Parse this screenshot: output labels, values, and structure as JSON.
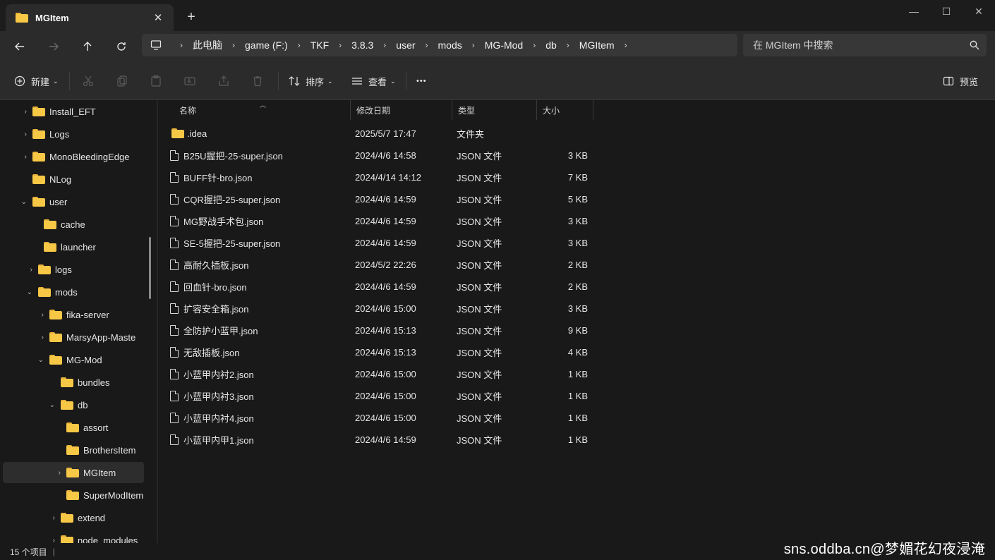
{
  "window": {
    "tab_title": "MGItem",
    "tab_close_glyph": "✕",
    "new_tab_glyph": "+",
    "minimize_glyph": "—",
    "maximize_glyph": "☐",
    "close_glyph": "✕"
  },
  "address": {
    "crumbs": [
      "此电脑",
      "game (F:)",
      "TKF",
      "3.8.3",
      "user",
      "mods",
      "MG-Mod",
      "db",
      "MGItem"
    ],
    "search_placeholder": "在 MGItem 中搜索"
  },
  "toolbar": {
    "new_label": "新建",
    "sort_label": "排序",
    "view_label": "查看",
    "more_glyph": "•••",
    "preview_label": "预览"
  },
  "nav_tree": [
    {
      "label": "Install_EFT",
      "chevron": "›"
    },
    {
      "label": "Logs",
      "chevron": "›"
    },
    {
      "label": "MonoBleedingEdge",
      "chevron": "›"
    },
    {
      "label": "NLog",
      "chevron": ""
    },
    {
      "label": "user",
      "chevron": "⌄"
    },
    {
      "label": "cache",
      "chevron": ""
    },
    {
      "label": "launcher",
      "chevron": ""
    },
    {
      "label": "logs",
      "chevron": "›"
    },
    {
      "label": "mods",
      "chevron": "⌄"
    },
    {
      "label": "fika-server",
      "chevron": "›"
    },
    {
      "label": "MarsyApp-Maste",
      "chevron": "›"
    },
    {
      "label": "MG-Mod",
      "chevron": "⌄"
    },
    {
      "label": "bundles",
      "chevron": ""
    },
    {
      "label": "db",
      "chevron": "⌄"
    },
    {
      "label": "assort",
      "chevron": ""
    },
    {
      "label": "BrothersItem",
      "chevron": ""
    },
    {
      "label": "MGItem",
      "chevron": "›"
    },
    {
      "label": "SuperModItem",
      "chevron": ""
    },
    {
      "label": "extend",
      "chevron": "›"
    },
    {
      "label": "node_modules",
      "chevron": "›"
    }
  ],
  "columns": {
    "name": "名称",
    "date": "修改日期",
    "type": "类型",
    "size": "大小",
    "sort_caret": "︿"
  },
  "files": [
    {
      "name": ".idea",
      "date": "2025/5/7 17:47",
      "type": "文件夹",
      "size": "",
      "kind": "folder"
    },
    {
      "name": "B25U握把-25-super.json",
      "date": "2024/4/6 14:58",
      "type": "JSON 文件",
      "size": "3 KB",
      "kind": "file"
    },
    {
      "name": "BUFF针-bro.json",
      "date": "2024/4/14 14:12",
      "type": "JSON 文件",
      "size": "7 KB",
      "kind": "file"
    },
    {
      "name": "CQR握把-25-super.json",
      "date": "2024/4/6 14:59",
      "type": "JSON 文件",
      "size": "5 KB",
      "kind": "file"
    },
    {
      "name": "MG野战手术包.json",
      "date": "2024/4/6 14:59",
      "type": "JSON 文件",
      "size": "3 KB",
      "kind": "file"
    },
    {
      "name": "SE-5握把-25-super.json",
      "date": "2024/4/6 14:59",
      "type": "JSON 文件",
      "size": "3 KB",
      "kind": "file"
    },
    {
      "name": "高耐久插板.json",
      "date": "2024/5/2 22:26",
      "type": "JSON 文件",
      "size": "2 KB",
      "kind": "file"
    },
    {
      "name": "回血针-bro.json",
      "date": "2024/4/6 14:59",
      "type": "JSON 文件",
      "size": "2 KB",
      "kind": "file"
    },
    {
      "name": "扩容安全箱.json",
      "date": "2024/4/6 15:00",
      "type": "JSON 文件",
      "size": "3 KB",
      "kind": "file"
    },
    {
      "name": "全防护小蓝甲.json",
      "date": "2024/4/6 15:13",
      "type": "JSON 文件",
      "size": "9 KB",
      "kind": "file"
    },
    {
      "name": "无敌插板.json",
      "date": "2024/4/6 15:13",
      "type": "JSON 文件",
      "size": "4 KB",
      "kind": "file"
    },
    {
      "name": "小蓝甲内衬2.json",
      "date": "2024/4/6 15:00",
      "type": "JSON 文件",
      "size": "1 KB",
      "kind": "file"
    },
    {
      "name": "小蓝甲内衬3.json",
      "date": "2024/4/6 15:00",
      "type": "JSON 文件",
      "size": "1 KB",
      "kind": "file"
    },
    {
      "name": "小蓝甲内衬4.json",
      "date": "2024/4/6 15:00",
      "type": "JSON 文件",
      "size": "1 KB",
      "kind": "file"
    },
    {
      "name": "小蓝甲内甲1.json",
      "date": "2024/4/6 14:59",
      "type": "JSON 文件",
      "size": "1 KB",
      "kind": "file"
    }
  ],
  "status": {
    "item_count": "15 个项目",
    "divider": "|"
  },
  "watermark": "sns.oddba.cn@梦媚花幻夜浸淹"
}
